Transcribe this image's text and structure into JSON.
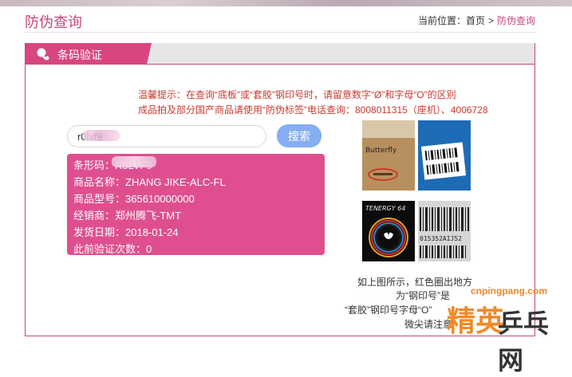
{
  "page_title": "防伪查询",
  "breadcrumb": {
    "prefix": "当前位置：",
    "home": "首页",
    "sep": ">",
    "current": "防伪查询"
  },
  "tab": {
    "label": "条码验证",
    "icon": "ping-pong-icon"
  },
  "notice": {
    "line1": "温馨提示：在查询“底板”或“套胶”钢印号时，请留意数字“Ø”和字母“O”的区别",
    "line2": "成品拍及部分国产商品请使用“防伪标签”电话查询：8008011315（座机）、4006728"
  },
  "search": {
    "value": "r0lvf9",
    "button_label": "搜索"
  },
  "result": {
    "barcode": "条形码：R5LVF9",
    "name": "商品名称：ZHANG JIKE-ALC-FL",
    "model": "商品型号：365610000000",
    "dealer": "经销商：郑州腾飞-TMT",
    "ship_date": "发货日期：2018-01-24",
    "verify_count": "此前验证次数：0"
  },
  "photos": {
    "p1_text": "Butterfly",
    "p3_text": "TENERGY 64",
    "p4_text": "015352AIJ52"
  },
  "caption": {
    "line1": "如上图所示，红色圈出地方",
    "line2": "为“钢印号”是",
    "line3": "“套胶”钢印号字母“O”",
    "line4": "微尖请注意"
  },
  "watermark": {
    "url": "cnpingpang.com",
    "part1": "精英",
    "part2": "乒乓网"
  }
}
